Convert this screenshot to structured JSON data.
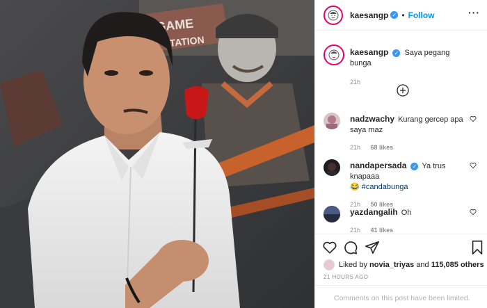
{
  "post": {
    "username": "kaesangp",
    "verified": true,
    "follow_label": "Follow",
    "caption": "Saya pegang bunga",
    "caption_time": "21h",
    "load_more_icon": "plus-circle-icon"
  },
  "photo": {
    "description_icon": "photo",
    "mural_text_top": "GAME",
    "mural_text_bottom": "STATION"
  },
  "comments": [
    {
      "username": "nadzwachy",
      "verified": false,
      "text": "Kurang gercep apa saya maz",
      "time": "21h",
      "likes": "68 likes"
    },
    {
      "username": "nandapersada",
      "verified": true,
      "text": "Ya trus knapaaa",
      "emoji": "😂",
      "hashtag": "#candabunga",
      "time": "21h",
      "likes": "50 likes"
    },
    {
      "username": "yazdangalih",
      "verified": false,
      "text": "Oh",
      "time": "21h",
      "likes": "41 likes"
    }
  ],
  "actions": {
    "liked_by_prefix": "Liked by",
    "liked_by_user": "novia_triyas",
    "liked_and": "and",
    "liked_count": "115,085 others",
    "timestamp": "21 HOURS AGO",
    "limited_notice": "Comments on this post have been limited."
  },
  "colors": {
    "link": "#0095f6",
    "verified": "#3897f0",
    "muted": "#8e8e8e",
    "ring": "#e6006f"
  }
}
